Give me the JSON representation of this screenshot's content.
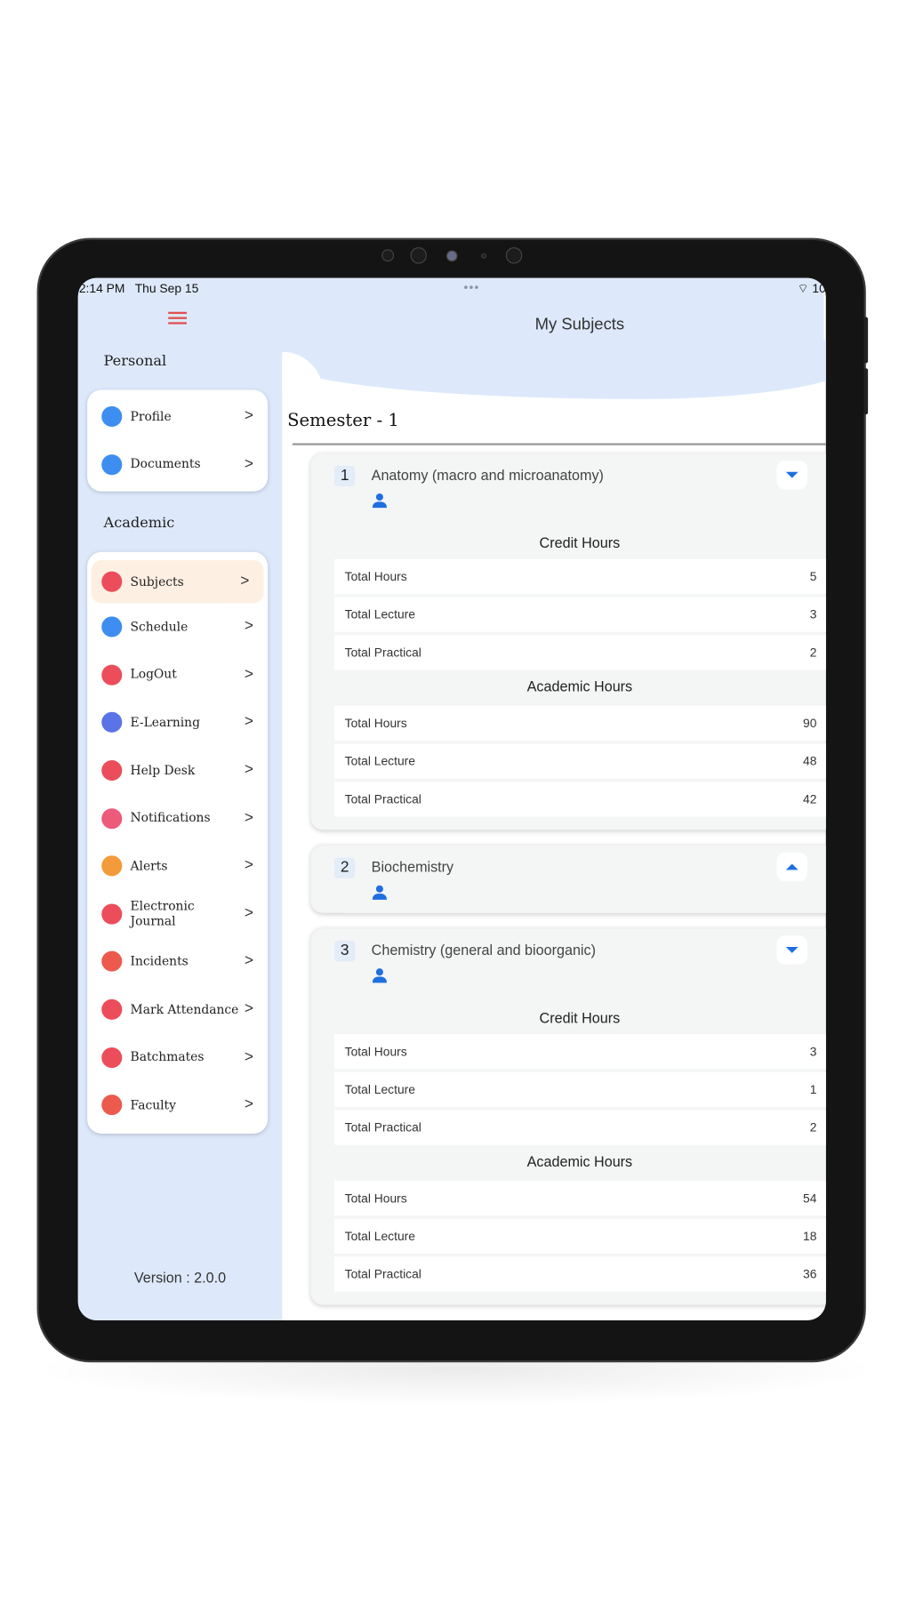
{
  "status_bar": {
    "time": "2:14 PM",
    "date": "Thu Sep 15",
    "battery": "10"
  },
  "sidebar": {
    "personal_label": "Personal",
    "personal_items": [
      {
        "label": "Profile",
        "icon": "profile-icon",
        "color": "#3d8ef0"
      },
      {
        "label": "Documents",
        "icon": "documents-icon",
        "color": "#3d8ef0"
      }
    ],
    "academic_label": "Academic",
    "academic_items": [
      {
        "label": "Subjects",
        "icon": "book-icon",
        "color": "#ec4d5a"
      },
      {
        "label": "Schedule",
        "icon": "clock-icon",
        "color": "#3d8ef0"
      },
      {
        "label": "LogOut",
        "icon": "power-icon",
        "color": "#ec4d5a"
      },
      {
        "label": "E-Learning",
        "icon": "monitor-icon",
        "color": "#5a73e6"
      },
      {
        "label": "Help Desk",
        "icon": "help-icon",
        "color": "#ec4d5a"
      },
      {
        "label": "Notifications",
        "icon": "bell-icon",
        "color": "#ee5a7a"
      },
      {
        "label": "Alerts",
        "icon": "alarm-icon",
        "color": "#f39a3a"
      },
      {
        "label": "Electronic Journal",
        "icon": "journal-icon",
        "color": "#ec4d5a"
      },
      {
        "label": "Incidents",
        "icon": "warning-icon",
        "color": "#ec5a4d"
      },
      {
        "label": "Mark Attendance",
        "icon": "attendance-icon",
        "color": "#ec4d5a"
      },
      {
        "label": "Batchmates",
        "icon": "group-icon",
        "color": "#ec4d5a"
      },
      {
        "label": "Faculty",
        "icon": "faculty-icon",
        "color": "#ec5a4d"
      }
    ],
    "version": "Version :  2.0.0"
  },
  "main": {
    "title": "My Subjects",
    "semester": "Semester - 1",
    "subjects": [
      {
        "num": "1",
        "name": "Anatomy  (macro and microanatomy)",
        "expanded": true,
        "credit_label": "Credit Hours",
        "credit": [
          {
            "k": "Total Hours",
            "v": "5"
          },
          {
            "k": "Total Lecture",
            "v": "3"
          },
          {
            "k": "Total Practical",
            "v": "2"
          }
        ],
        "academic_label": "Academic Hours",
        "academic": [
          {
            "k": "Total Hours",
            "v": "90"
          },
          {
            "k": "Total Lecture",
            "v": "48"
          },
          {
            "k": "Total Practical",
            "v": "42"
          }
        ]
      },
      {
        "num": "2",
        "name": "Biochemistry",
        "expanded": false
      },
      {
        "num": "3",
        "name": "Chemistry (general and bioorganic)",
        "expanded": true,
        "credit_label": "Credit Hours",
        "credit": [
          {
            "k": "Total Hours",
            "v": "3"
          },
          {
            "k": "Total Lecture",
            "v": "1"
          },
          {
            "k": "Total Practical",
            "v": "2"
          }
        ],
        "academic_label": "Academic Hours",
        "academic": [
          {
            "k": "Total Hours",
            "v": "54"
          },
          {
            "k": "Total Lecture",
            "v": "18"
          },
          {
            "k": "Total Practical",
            "v": "36"
          }
        ]
      }
    ]
  }
}
